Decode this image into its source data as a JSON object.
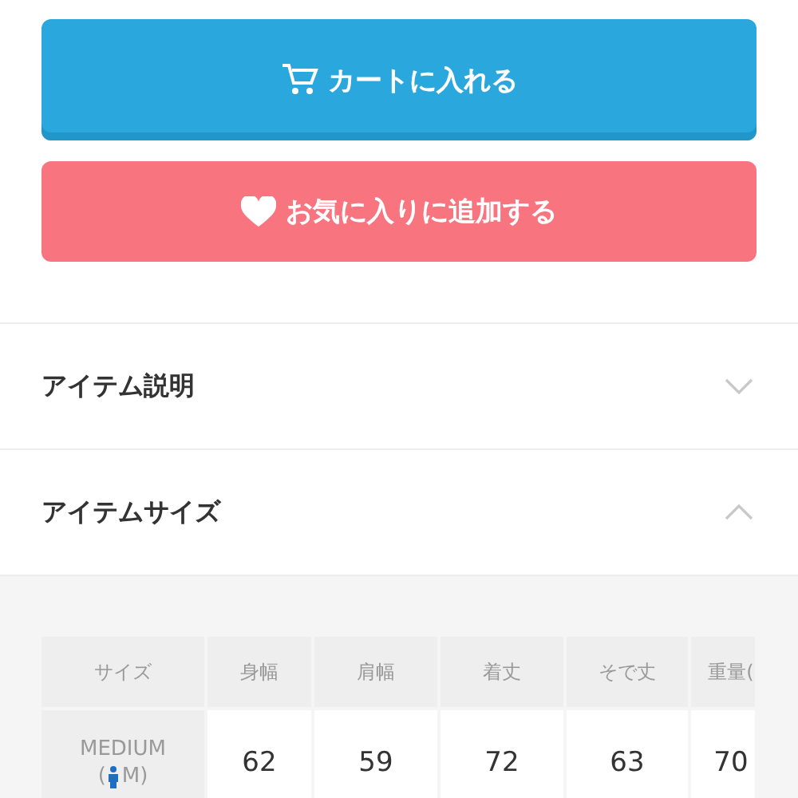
{
  "buttons": [
    {
      "kind": "cart",
      "label": "カートに入れる"
    },
    {
      "kind": "favorite",
      "label": "お気に入りに追加する"
    }
  ],
  "sections": [
    {
      "title": "アイテム説明",
      "expanded": false
    },
    {
      "title": "アイテムサイズ",
      "expanded": true
    }
  ],
  "size_table": {
    "columns": [
      "サイズ",
      "身幅",
      "肩幅",
      "着丈",
      "そで丈",
      "重量("
    ],
    "rows": [
      {
        "size": "MEDIUM",
        "size_open": "(",
        "size_close": "M)",
        "values": [
          "62",
          "59",
          "72",
          "63",
          "70"
        ]
      }
    ]
  }
}
